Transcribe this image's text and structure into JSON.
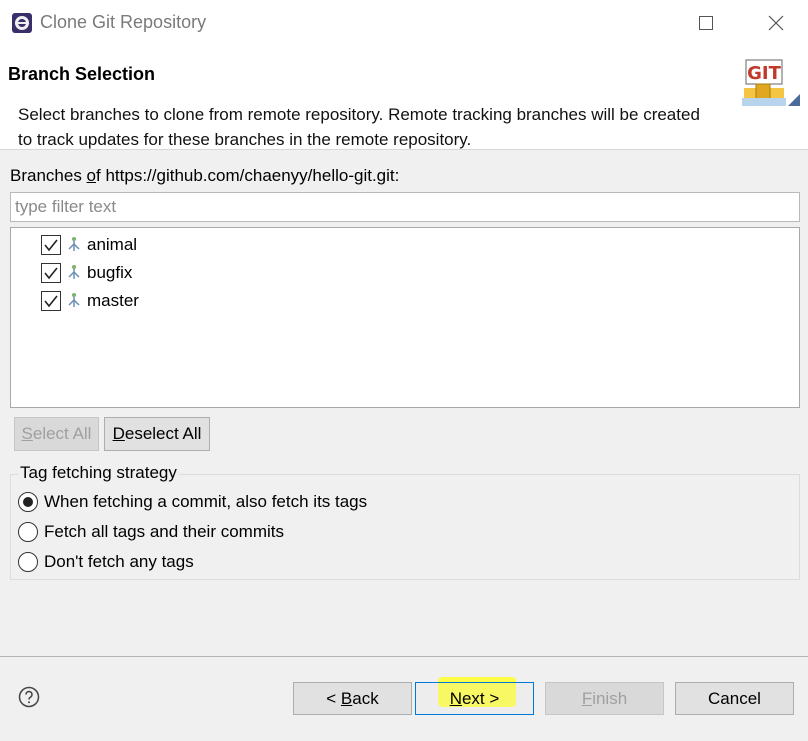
{
  "window": {
    "title": "Clone Git Repository",
    "maximize_icon": "maximize-icon",
    "close_icon": "close-icon"
  },
  "header": {
    "title": "Branch Selection",
    "description": "Select branches to clone from remote repository. Remote tracking branches will be created to track updates for these branches in the remote repository.",
    "banner_text": "GIT"
  },
  "branches": {
    "label_prefix": "Branches ",
    "label_underlined": "o",
    "label_suffix": "f https://github.com/chaenyy/hello-git.git:",
    "filter_placeholder": "type filter text",
    "items": [
      {
        "name": "animal",
        "checked": true
      },
      {
        "name": "bugfix",
        "checked": true
      },
      {
        "name": "master",
        "checked": true
      }
    ]
  },
  "selection_buttons": {
    "select_all_u": "S",
    "select_all_rest": "elect All",
    "deselect_all_u": "D",
    "deselect_all_rest": "eselect All"
  },
  "tag_fetching": {
    "title": "Tag fetching strategy",
    "options": [
      {
        "label": "When fetching a commit, also fetch its tags",
        "selected": true
      },
      {
        "label": "Fetch all tags and their commits",
        "selected": false
      },
      {
        "label": "Don't fetch any tags",
        "selected": false
      }
    ]
  },
  "footer": {
    "help_icon": "help-icon",
    "back_pre": "< ",
    "back_u": "B",
    "back_rest": "ack",
    "next_u": "N",
    "next_rest": "ext >",
    "finish_u": "F",
    "finish_rest": "inish",
    "cancel": "Cancel"
  },
  "colors": {
    "accent": "#0078d7",
    "highlight": "#ffff33"
  }
}
